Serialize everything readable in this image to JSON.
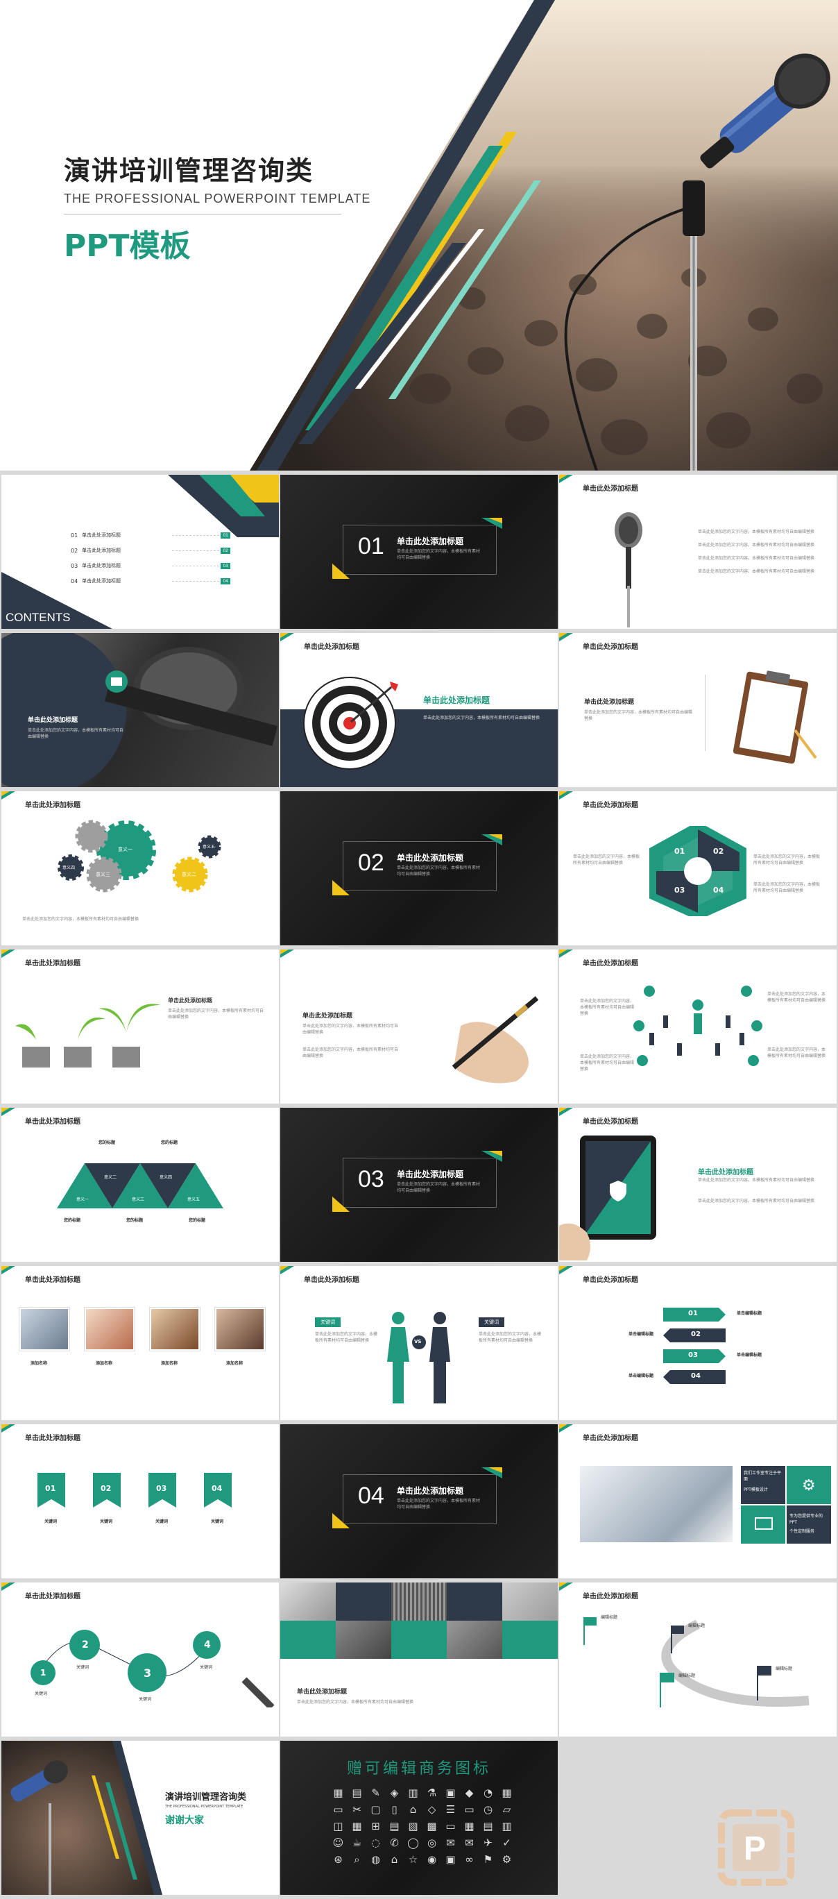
{
  "hero": {
    "title": "演讲培训管理咨询类",
    "subtitle": "THE PROFESSIONAL POWERPOINT TEMPLATE",
    "ppt_label": "PPT模板"
  },
  "common": {
    "slide_title": "单击此处添加标题",
    "body": "单击此处添加您的文字内容，本模板所有素材均可自由编辑替换",
    "num_text": "单击此处添加标题"
  },
  "contents": {
    "label": "CONTENTS",
    "items": [
      {
        "num": "01",
        "text": "单击此处添加标题",
        "badge": "01"
      },
      {
        "num": "02",
        "text": "单击此处添加标题",
        "badge": "02"
      },
      {
        "num": "03",
        "text": "单击此处添加标题",
        "badge": "03"
      },
      {
        "num": "04",
        "text": "单击此处添加标题",
        "badge": "04"
      }
    ]
  },
  "sections": [
    {
      "num": "01",
      "title": "单击此处添加标题"
    },
    {
      "num": "02",
      "title": "单击此处添加标题"
    },
    {
      "num": "03",
      "title": "单击此处添加标题"
    },
    {
      "num": "04",
      "title": "单击此处添加标题"
    }
  ],
  "gears": [
    "意义一",
    "意义二",
    "意义三",
    "意义四",
    "意义五"
  ],
  "hexagon": [
    "01",
    "02",
    "03",
    "04"
  ],
  "triangles": [
    "意义一",
    "意义二",
    "意义三",
    "意义四",
    "意义五"
  ],
  "tri_labels": [
    "您的标题",
    "您的标题",
    "您的标题",
    "您的标题",
    "您的标题"
  ],
  "photo_labels": [
    "添加名称",
    "添加名称",
    "添加名称",
    "添加名称"
  ],
  "vs": {
    "left": "关键词",
    "right": "关键词",
    "mid": "VS"
  },
  "arrows": [
    "01",
    "02",
    "03",
    "04"
  ],
  "arrow_label": "单击编辑标题",
  "tags": [
    "01",
    "02",
    "03",
    "04"
  ],
  "tag_label": "关键词",
  "circles": [
    "1",
    "2",
    "3",
    "4"
  ],
  "circle_label": "关键词",
  "laptop_text": [
    "我们工作室专注于平面",
    "PPT模板设计",
    "专为您提供专业的PPT",
    "个性定制服务"
  ],
  "flags_label": "编辑标题",
  "end": {
    "title": "演讲培训管理咨询类",
    "subtitle": "THE PROFESSIONAL POWERPOINT TEMPLATE",
    "thanks": "谢谢大家"
  },
  "icons_slide": {
    "title": "赠可编辑商务图标"
  },
  "watermark": {
    "letter": "P"
  }
}
